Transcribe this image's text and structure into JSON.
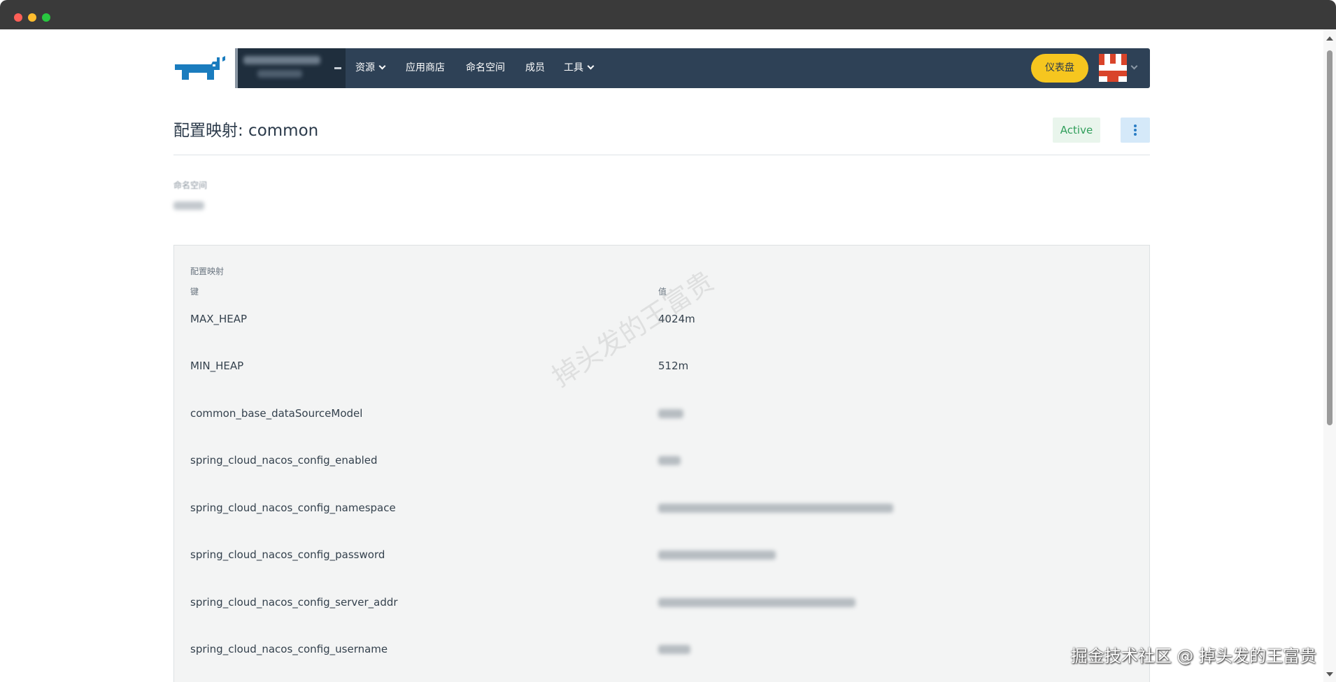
{
  "nav": {
    "items": [
      {
        "label": "资源",
        "has_caret": true
      },
      {
        "label": "应用商店",
        "has_caret": false
      },
      {
        "label": "命名空间",
        "has_caret": false
      },
      {
        "label": "成员",
        "has_caret": false
      },
      {
        "label": "工具",
        "has_caret": true
      }
    ],
    "dashboard_label": "仪表盘"
  },
  "page": {
    "title": "配置映射: common",
    "status": "Active",
    "namespace_label": "命名空间"
  },
  "configmap": {
    "section_title": "配置映射",
    "key_header": "键",
    "value_header": "值",
    "rows": [
      {
        "key": "MAX_HEAP",
        "value": "4024m"
      },
      {
        "key": "MIN_HEAP",
        "value": "512m"
      },
      {
        "key": "common_base_dataSourceModel",
        "value": ""
      },
      {
        "key": "spring_cloud_nacos_config_enabled",
        "value": ""
      },
      {
        "key": "spring_cloud_nacos_config_namespace",
        "value": ""
      },
      {
        "key": "spring_cloud_nacos_config_password",
        "value": ""
      },
      {
        "key": "spring_cloud_nacos_config_server_addr",
        "value": ""
      },
      {
        "key": "spring_cloud_nacos_config_username",
        "value": ""
      }
    ]
  },
  "watermarks": {
    "diagonal": "掉头发的王富贵",
    "corner": "掘金技术社区 @ 掉头发的王富贵"
  },
  "colors": {
    "navbar": "#2e4156",
    "dashboard_button": "#f6c61f",
    "status_active": "#2f9e5a",
    "logo_blue": "#1a7cbe"
  },
  "icons": [
    "rancher-logo-icon",
    "chevron-down-icon",
    "kebab-menu-icon",
    "user-avatar-icon"
  ]
}
